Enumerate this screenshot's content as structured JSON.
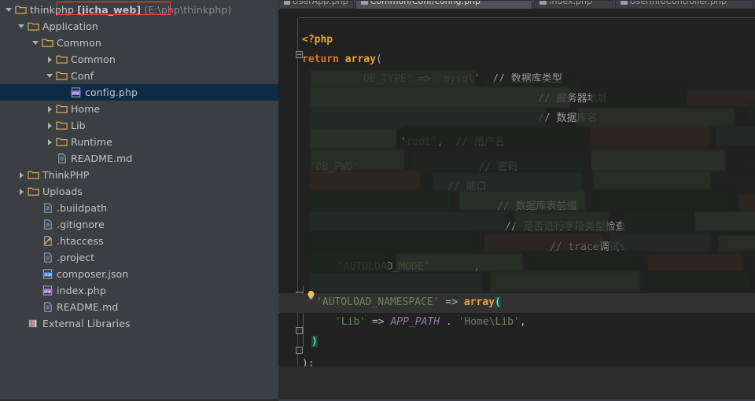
{
  "app": {
    "theme_bg_sidebar": "#3c3f41",
    "theme_bg_editor": "#212121",
    "accent_selected": "#0d2b45",
    "annotation_color": "#ef4444"
  },
  "sidebar": {
    "items": [
      {
        "label": "thinkphp ",
        "bold": "[jicha_web]",
        "dim": " (E:\\php\\thinkphp)",
        "indent": 0,
        "arrow": "down",
        "icon": "folder-icon",
        "type": "folder",
        "selected": false
      },
      {
        "label": "Application",
        "indent": 1,
        "arrow": "down",
        "icon": "folder-icon",
        "type": "folder",
        "selected": false
      },
      {
        "label": "Common",
        "indent": 2,
        "arrow": "down",
        "icon": "folder-icon",
        "type": "folder",
        "selected": false
      },
      {
        "label": "Common",
        "indent": 3,
        "arrow": "right",
        "icon": "folder-icon",
        "type": "folder",
        "selected": false
      },
      {
        "label": "Conf",
        "indent": 3,
        "arrow": "down",
        "icon": "folder-icon",
        "type": "folder",
        "selected": false
      },
      {
        "label": "config.php",
        "indent": 4,
        "arrow": "none",
        "icon": "php-file-icon",
        "type": "php",
        "selected": true
      },
      {
        "label": "Home",
        "indent": 3,
        "arrow": "right",
        "icon": "folder-icon",
        "type": "folder",
        "selected": false
      },
      {
        "label": "Lib",
        "indent": 3,
        "arrow": "right",
        "icon": "folder-icon",
        "type": "folder",
        "selected": false
      },
      {
        "label": "Runtime",
        "indent": 3,
        "arrow": "right",
        "icon": "folder-icon",
        "type": "folder",
        "selected": false
      },
      {
        "label": "README.md",
        "indent": 3,
        "arrow": "none",
        "icon": "text-file-icon",
        "type": "text",
        "selected": false
      },
      {
        "label": "ThinkPHP",
        "indent": 1,
        "arrow": "right",
        "icon": "folder-icon",
        "type": "folder",
        "selected": false
      },
      {
        "label": "Uploads",
        "indent": 1,
        "arrow": "right",
        "icon": "folder-icon",
        "type": "folder",
        "selected": false
      },
      {
        "label": ".buildpath",
        "indent": 2,
        "arrow": "none",
        "icon": "xml-file-icon",
        "type": "text",
        "selected": false
      },
      {
        "label": ".gitignore",
        "indent": 2,
        "arrow": "none",
        "icon": "text-file-icon",
        "type": "text",
        "selected": false
      },
      {
        "label": ".htaccess",
        "indent": 2,
        "arrow": "none",
        "icon": "htaccess-file-icon",
        "type": "htaccess",
        "selected": false
      },
      {
        "label": ".project",
        "indent": 2,
        "arrow": "none",
        "icon": "xml-file-icon",
        "type": "text",
        "selected": false
      },
      {
        "label": "composer.json",
        "indent": 2,
        "arrow": "none",
        "icon": "json-file-icon",
        "type": "json",
        "selected": false
      },
      {
        "label": "index.php",
        "indent": 2,
        "arrow": "none",
        "icon": "php-file-icon",
        "type": "php",
        "selected": false
      },
      {
        "label": "README.md",
        "indent": 2,
        "arrow": "none",
        "icon": "text-file-icon",
        "type": "text",
        "selected": false
      },
      {
        "label": "External Libraries",
        "indent": 1,
        "arrow": "none",
        "icon": "libraries-icon",
        "type": "lib",
        "selected": false
      }
    ]
  },
  "editor": {
    "tabs": [
      {
        "label": "UserApp.php",
        "active": false
      },
      {
        "label": "Common/Conf/config.php",
        "active": true
      },
      {
        "label": "index.php",
        "active": false
      },
      {
        "label": "UserInfoController.php",
        "active": false
      }
    ],
    "code": {
      "l1_php_open": "<?php",
      "l2_return": "return",
      "l2_array": "array",
      "l2_paren": "(",
      "l3_key": "'DB_TYPE'",
      "l3_arrow": "=>",
      "l3_val": "'mysql'",
      "l3_comment": "// 数据库类型",
      "l4_comment": "// 服务器地址",
      "l5_comment": "// 数据库名",
      "l6_val": "'root'",
      "l6_comment": "// 用户名",
      "l7_key": "'DB_PWD'",
      "l7_comment": "// 密码",
      "l8_comment": "// 端口",
      "l9_comment": "// 数据库表前缀",
      "l10_comment": "// 是否进行字段类型检查",
      "l11_comment": "// trace调试s",
      "l12_key": "'AUTOLOAD_MODE'",
      "l13_key": "'AUTOLOAD_NAMESPACE'",
      "l13_arrow": "=>",
      "l13_array": "array",
      "l13_paren": "(",
      "l14_key": "'Lib'",
      "l14_arrow": "=>",
      "l14_const": "APP_PATH",
      "l14_dot": ".",
      "l14_val": "'Home\\Lib'",
      "l14_comma": ",",
      "l15_close": ")",
      "l16_close": ")",
      "l16_semi": ";"
    }
  }
}
